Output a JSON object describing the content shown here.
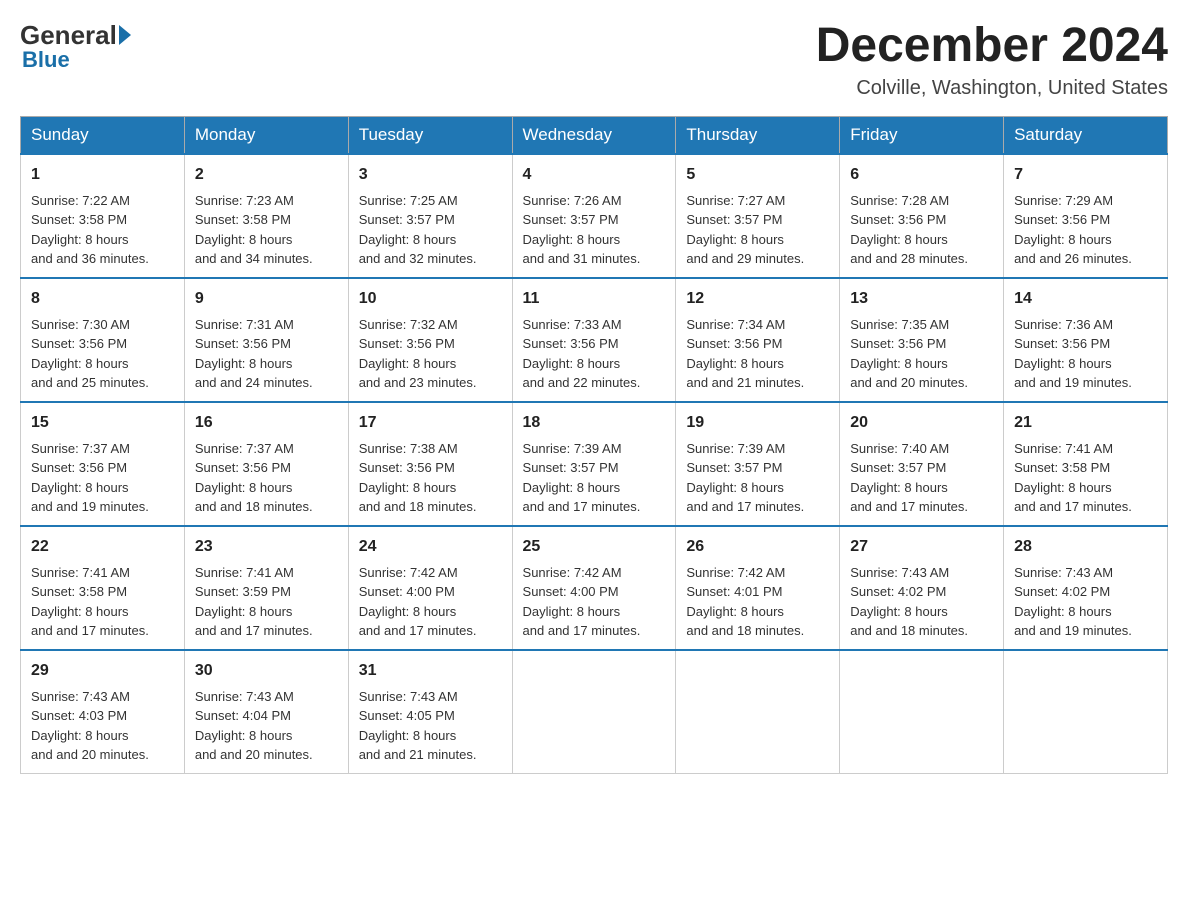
{
  "logo": {
    "general": "General",
    "blue": "Blue"
  },
  "header": {
    "month": "December 2024",
    "location": "Colville, Washington, United States"
  },
  "days": [
    "Sunday",
    "Monday",
    "Tuesday",
    "Wednesday",
    "Thursday",
    "Friday",
    "Saturday"
  ],
  "weeks": [
    [
      {
        "day": 1,
        "sunrise": "7:22 AM",
        "sunset": "3:58 PM",
        "daylight": "8 hours and 36 minutes."
      },
      {
        "day": 2,
        "sunrise": "7:23 AM",
        "sunset": "3:58 PM",
        "daylight": "8 hours and 34 minutes."
      },
      {
        "day": 3,
        "sunrise": "7:25 AM",
        "sunset": "3:57 PM",
        "daylight": "8 hours and 32 minutes."
      },
      {
        "day": 4,
        "sunrise": "7:26 AM",
        "sunset": "3:57 PM",
        "daylight": "8 hours and 31 minutes."
      },
      {
        "day": 5,
        "sunrise": "7:27 AM",
        "sunset": "3:57 PM",
        "daylight": "8 hours and 29 minutes."
      },
      {
        "day": 6,
        "sunrise": "7:28 AM",
        "sunset": "3:56 PM",
        "daylight": "8 hours and 28 minutes."
      },
      {
        "day": 7,
        "sunrise": "7:29 AM",
        "sunset": "3:56 PM",
        "daylight": "8 hours and 26 minutes."
      }
    ],
    [
      {
        "day": 8,
        "sunrise": "7:30 AM",
        "sunset": "3:56 PM",
        "daylight": "8 hours and 25 minutes."
      },
      {
        "day": 9,
        "sunrise": "7:31 AM",
        "sunset": "3:56 PM",
        "daylight": "8 hours and 24 minutes."
      },
      {
        "day": 10,
        "sunrise": "7:32 AM",
        "sunset": "3:56 PM",
        "daylight": "8 hours and 23 minutes."
      },
      {
        "day": 11,
        "sunrise": "7:33 AM",
        "sunset": "3:56 PM",
        "daylight": "8 hours and 22 minutes."
      },
      {
        "day": 12,
        "sunrise": "7:34 AM",
        "sunset": "3:56 PM",
        "daylight": "8 hours and 21 minutes."
      },
      {
        "day": 13,
        "sunrise": "7:35 AM",
        "sunset": "3:56 PM",
        "daylight": "8 hours and 20 minutes."
      },
      {
        "day": 14,
        "sunrise": "7:36 AM",
        "sunset": "3:56 PM",
        "daylight": "8 hours and 19 minutes."
      }
    ],
    [
      {
        "day": 15,
        "sunrise": "7:37 AM",
        "sunset": "3:56 PM",
        "daylight": "8 hours and 19 minutes."
      },
      {
        "day": 16,
        "sunrise": "7:37 AM",
        "sunset": "3:56 PM",
        "daylight": "8 hours and 18 minutes."
      },
      {
        "day": 17,
        "sunrise": "7:38 AM",
        "sunset": "3:56 PM",
        "daylight": "8 hours and 18 minutes."
      },
      {
        "day": 18,
        "sunrise": "7:39 AM",
        "sunset": "3:57 PM",
        "daylight": "8 hours and 17 minutes."
      },
      {
        "day": 19,
        "sunrise": "7:39 AM",
        "sunset": "3:57 PM",
        "daylight": "8 hours and 17 minutes."
      },
      {
        "day": 20,
        "sunrise": "7:40 AM",
        "sunset": "3:57 PM",
        "daylight": "8 hours and 17 minutes."
      },
      {
        "day": 21,
        "sunrise": "7:41 AM",
        "sunset": "3:58 PM",
        "daylight": "8 hours and 17 minutes."
      }
    ],
    [
      {
        "day": 22,
        "sunrise": "7:41 AM",
        "sunset": "3:58 PM",
        "daylight": "8 hours and 17 minutes."
      },
      {
        "day": 23,
        "sunrise": "7:41 AM",
        "sunset": "3:59 PM",
        "daylight": "8 hours and 17 minutes."
      },
      {
        "day": 24,
        "sunrise": "7:42 AM",
        "sunset": "4:00 PM",
        "daylight": "8 hours and 17 minutes."
      },
      {
        "day": 25,
        "sunrise": "7:42 AM",
        "sunset": "4:00 PM",
        "daylight": "8 hours and 17 minutes."
      },
      {
        "day": 26,
        "sunrise": "7:42 AM",
        "sunset": "4:01 PM",
        "daylight": "8 hours and 18 minutes."
      },
      {
        "day": 27,
        "sunrise": "7:43 AM",
        "sunset": "4:02 PM",
        "daylight": "8 hours and 18 minutes."
      },
      {
        "day": 28,
        "sunrise": "7:43 AM",
        "sunset": "4:02 PM",
        "daylight": "8 hours and 19 minutes."
      }
    ],
    [
      {
        "day": 29,
        "sunrise": "7:43 AM",
        "sunset": "4:03 PM",
        "daylight": "8 hours and 20 minutes."
      },
      {
        "day": 30,
        "sunrise": "7:43 AM",
        "sunset": "4:04 PM",
        "daylight": "8 hours and 20 minutes."
      },
      {
        "day": 31,
        "sunrise": "7:43 AM",
        "sunset": "4:05 PM",
        "daylight": "8 hours and 21 minutes."
      },
      null,
      null,
      null,
      null
    ]
  ]
}
